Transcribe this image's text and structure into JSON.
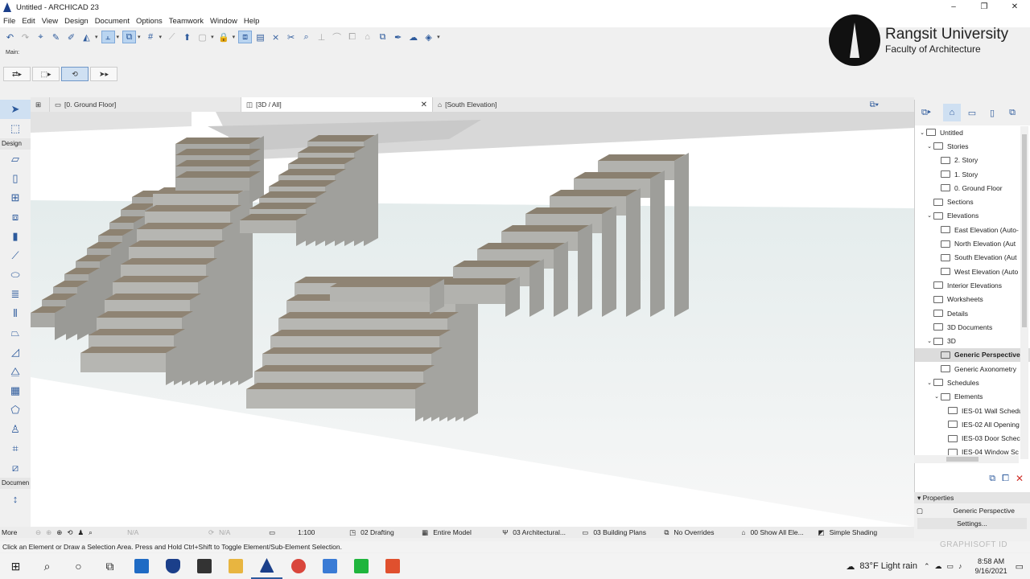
{
  "window": {
    "title": "Untitled - ARCHICAD 23",
    "controls": [
      "–",
      "❐",
      "✕"
    ]
  },
  "menu": [
    "File",
    "Edit",
    "View",
    "Design",
    "Document",
    "Options",
    "Teamwork",
    "Window",
    "Help"
  ],
  "toolbar": {
    "main_label": "Main:"
  },
  "logo": {
    "university": "Rangsit University",
    "faculty": "Faculty of Architecture"
  },
  "toolbox": {
    "design_header": "Design",
    "document_header": "Documen",
    "more_label": "More"
  },
  "tabs": [
    {
      "label": "[0. Ground Floor]"
    },
    {
      "label": "[3D / All]"
    },
    {
      "label": "[South Elevation]"
    }
  ],
  "status": {
    "na1": "N/A",
    "na2": "N/A",
    "scale": "1:100",
    "drafting": "02 Drafting",
    "model": "Entire Model",
    "architectural": "03 Architectural...",
    "building_plans": "03 Building Plans",
    "overrides": "No Overrides",
    "show_all": "00 Show All Ele...",
    "shading": "Simple Shading"
  },
  "hint": "Click an Element or Draw a Selection Area. Press and Hold Ctrl+Shift to Toggle Element/Sub-Element Selection.",
  "navigator": {
    "items": [
      {
        "label": "Untitled",
        "level": 0,
        "toggle": "⌄"
      },
      {
        "label": "Stories",
        "level": 1,
        "toggle": "⌄"
      },
      {
        "label": "2. Story",
        "level": 2,
        "toggle": ""
      },
      {
        "label": "1. Story",
        "level": 2,
        "toggle": ""
      },
      {
        "label": "0. Ground Floor",
        "level": 2,
        "toggle": ""
      },
      {
        "label": "Sections",
        "level": 1,
        "toggle": ""
      },
      {
        "label": "Elevations",
        "level": 1,
        "toggle": "⌄"
      },
      {
        "label": "East Elevation (Auto-",
        "level": 2,
        "toggle": ""
      },
      {
        "label": "North Elevation (Aut",
        "level": 2,
        "toggle": ""
      },
      {
        "label": "South Elevation (Aut",
        "level": 2,
        "toggle": ""
      },
      {
        "label": "West Elevation (Auto",
        "level": 2,
        "toggle": ""
      },
      {
        "label": "Interior Elevations",
        "level": 1,
        "toggle": ""
      },
      {
        "label": "Worksheets",
        "level": 1,
        "toggle": ""
      },
      {
        "label": "Details",
        "level": 1,
        "toggle": ""
      },
      {
        "label": "3D Documents",
        "level": 1,
        "toggle": ""
      },
      {
        "label": "3D",
        "level": 1,
        "toggle": "⌄"
      },
      {
        "label": "Generic Perspective",
        "level": 2,
        "toggle": "",
        "selected": true
      },
      {
        "label": "Generic Axonometry",
        "level": 2,
        "toggle": ""
      },
      {
        "label": "Schedules",
        "level": 1,
        "toggle": "⌄"
      },
      {
        "label": "Elements",
        "level": 2,
        "toggle": "⌄"
      },
      {
        "label": "IES-01 Wall Schedu",
        "level": 3,
        "toggle": ""
      },
      {
        "label": "IES-02 All Opening",
        "level": 3,
        "toggle": ""
      },
      {
        "label": "IES-03 Door Schec",
        "level": 3,
        "toggle": ""
      },
      {
        "label": "IES-04 Window Sc",
        "level": 3,
        "toggle": ""
      }
    ]
  },
  "properties": {
    "header": "Properties",
    "value": "Generic Perspective",
    "settings": "Settings..."
  },
  "watermark": "GRAPHISOFT ID",
  "taskbar": {
    "weather": "83°F  Light rain",
    "time": "8:58 AM",
    "date": "9/16/2021"
  },
  "colors": {
    "accent": "#2d5a9c",
    "selection": "#cfe0f2",
    "close": "#d0302a"
  }
}
